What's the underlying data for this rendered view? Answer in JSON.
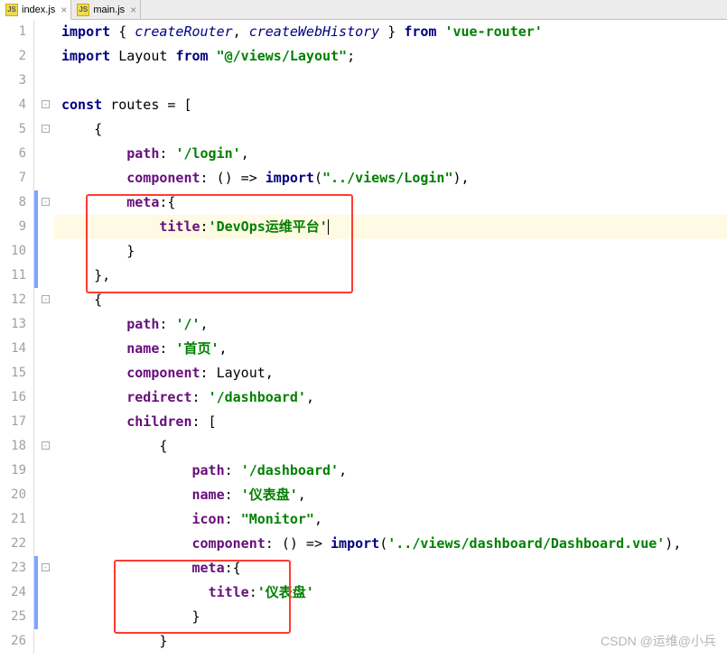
{
  "tabs": [
    {
      "label": "index.js",
      "active": true
    },
    {
      "label": "main.js",
      "active": false
    }
  ],
  "lines": {
    "l1": "1",
    "l2": "2",
    "l3": "3",
    "l4": "4",
    "l5": "5",
    "l6": "6",
    "l7": "7",
    "l8": "8",
    "l9": "9",
    "l10": "10",
    "l11": "11",
    "l12": "12",
    "l13": "13",
    "l14": "14",
    "l15": "15",
    "l16": "16",
    "l17": "17",
    "l18": "18",
    "l19": "19",
    "l20": "20",
    "l21": "21",
    "l22": "22",
    "l23": "23",
    "l24": "24",
    "l25": "25",
    "l26": "26"
  },
  "code": {
    "kw_import": "import",
    "kw_from": "from",
    "kw_const": "const",
    "em_createRouter": "createRouter",
    "em_createWebHistory": "createWebHistory",
    "str_vueRouter": "'vue-router'",
    "id_Layout": "Layout",
    "str_layoutPath": "\"@/views/Layout\"",
    "id_routes": "routes",
    "prop_path": "path",
    "prop_component": "component",
    "prop_meta": "meta",
    "prop_title": "title",
    "prop_name": "name",
    "prop_redirect": "redirect",
    "prop_children": "children",
    "prop_icon": "icon",
    "str_login": "'/login'",
    "str_loginImport": "\"../views/Login\"",
    "str_devops": "'DevOps运维平台'",
    "str_root": "'/'",
    "str_home": "'首页'",
    "str_dashboardPath": "'/dashboard'",
    "str_dashboard2": "'/dashboard'",
    "str_dashName": "'仪表盘'",
    "str_monitor": "\"Monitor\"",
    "str_dashImport": "'../views/dashboard/Dashboard.vue'",
    "str_dashTitle": "'仪表盘'",
    "fn_import": "import"
  },
  "watermark": "CSDN @运维@小兵"
}
